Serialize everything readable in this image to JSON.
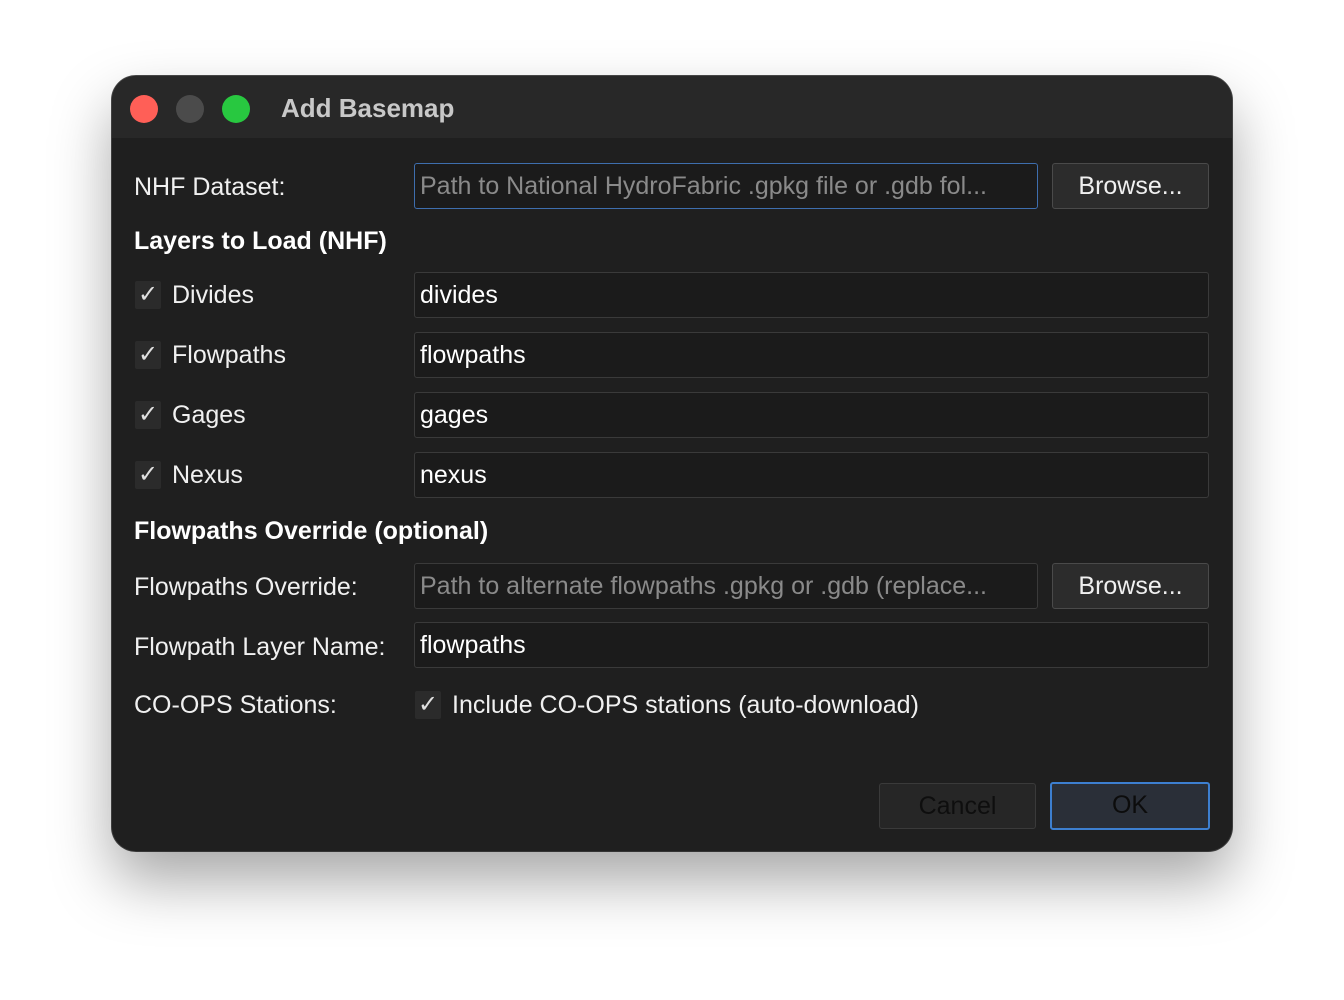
{
  "window": {
    "title": "Add Basemap"
  },
  "nhf_dataset": {
    "label": "NHF Dataset:",
    "placeholder": "Path to National HydroFabric .gpkg file or .gdb fol...",
    "browse_label": "Browse..."
  },
  "layers": {
    "heading": "Layers to Load (NHF)",
    "items": [
      {
        "label": "Divides",
        "checked": true,
        "value": "divides"
      },
      {
        "label": "Flowpaths",
        "checked": true,
        "value": "flowpaths"
      },
      {
        "label": "Gages",
        "checked": true,
        "value": "gages"
      },
      {
        "label": "Nexus",
        "checked": true,
        "value": "nexus"
      }
    ]
  },
  "override": {
    "heading": "Flowpaths Override (optional)",
    "label": "Flowpaths Override:",
    "placeholder": "Path to alternate flowpaths .gpkg or .gdb (replace...",
    "browse_label": "Browse...",
    "layer_name_label": "Flowpath Layer Name:",
    "layer_name_value": "flowpaths"
  },
  "coops": {
    "label": "CO-OPS Stations:",
    "checkbox_label": "Include CO-OPS stations (auto-download)",
    "checked": true
  },
  "footer": {
    "cancel_label": "Cancel",
    "ok_label": "OK"
  },
  "check_glyph": "✓",
  "colors": {
    "window_bg": "#1f1f1f",
    "titlebar_bg": "#282828",
    "close": "#ff5f57",
    "minimize": "#4b4b4b",
    "zoom": "#28c840",
    "focus_accent": "#3d7fd0"
  }
}
